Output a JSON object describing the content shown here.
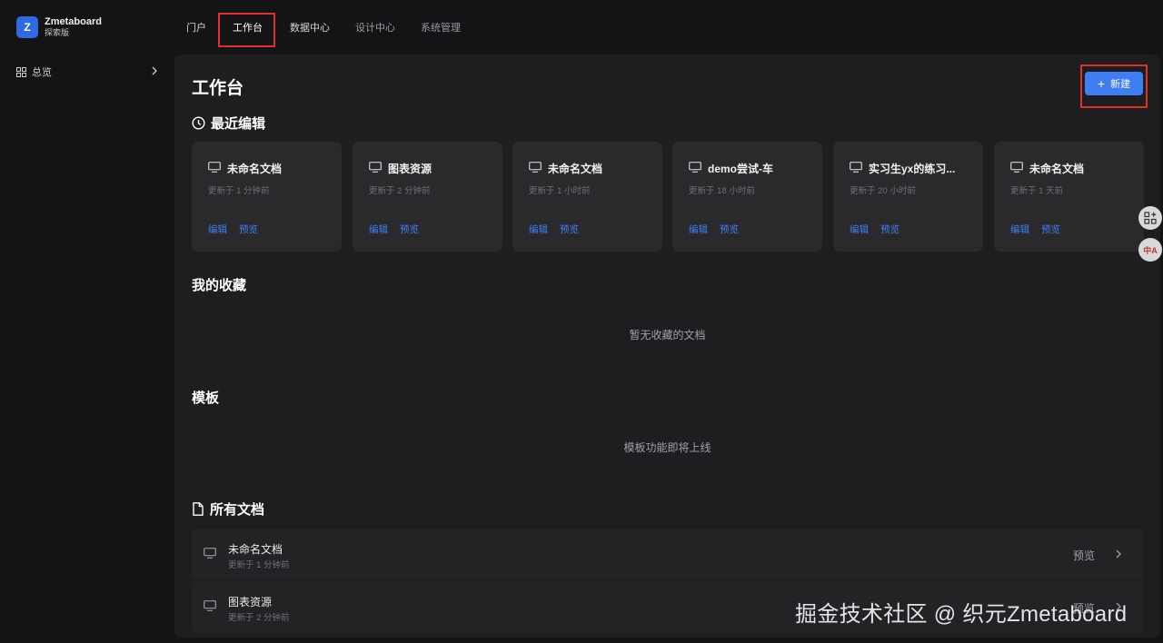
{
  "brand": {
    "logo_letter": "Z",
    "name": "Zmetaboard",
    "edition": "探索版"
  },
  "sidebar": {
    "items": [
      {
        "label": "总览",
        "icon": "grid-icon"
      }
    ]
  },
  "topnav": {
    "tabs": [
      {
        "label": "门户"
      },
      {
        "label": "工作台"
      },
      {
        "label": "数据中心"
      },
      {
        "label": "设计中心"
      },
      {
        "label": "系统管理"
      }
    ],
    "active": "工作台"
  },
  "page": {
    "title": "工作台",
    "new_button": "新建",
    "new_button_icon": "plus-icon"
  },
  "recent": {
    "title": "最近编辑",
    "cards": [
      {
        "name": "未命名文档",
        "time": "更新于 1 分钟前",
        "edit": "编辑",
        "preview": "预览"
      },
      {
        "name": "图表资源",
        "time": "更新于 2 分钟前",
        "edit": "编辑",
        "preview": "预览"
      },
      {
        "name": "未命名文档",
        "time": "更新于 1 小时前",
        "edit": "编辑",
        "preview": "预览"
      },
      {
        "name": "demo尝试-车",
        "time": "更新于 18 小时前",
        "edit": "编辑",
        "preview": "预览"
      },
      {
        "name": "实习生yx的练习...",
        "time": "更新于 20 小时前",
        "edit": "编辑",
        "preview": "预览"
      },
      {
        "name": "未命名文档",
        "time": "更新于 1 天前",
        "edit": "编辑",
        "preview": "预览"
      }
    ]
  },
  "favorites": {
    "title": "我的收藏",
    "empty": "暂无收藏的文档"
  },
  "templates": {
    "title": "模板",
    "empty": "模板功能即将上线"
  },
  "all_docs": {
    "title": "所有文档",
    "rows": [
      {
        "name": "未命名文档",
        "time": "更新于 1 分钟前",
        "preview": "预览"
      },
      {
        "name": "图表资源",
        "time": "更新于 2 分钟前",
        "preview": "预览"
      }
    ]
  },
  "floating": {
    "apps_icon": "apps-add-icon",
    "translate_icon": "translate-icon",
    "translate_label": "中A"
  },
  "watermark": "掘金技术社区 @ 织元Zmetaboard",
  "colors": {
    "accent": "#3f7ef2",
    "highlight_box": "#e0302a",
    "background": "#141416",
    "panel": "#1e1e21",
    "card": "#2a2a2d"
  }
}
